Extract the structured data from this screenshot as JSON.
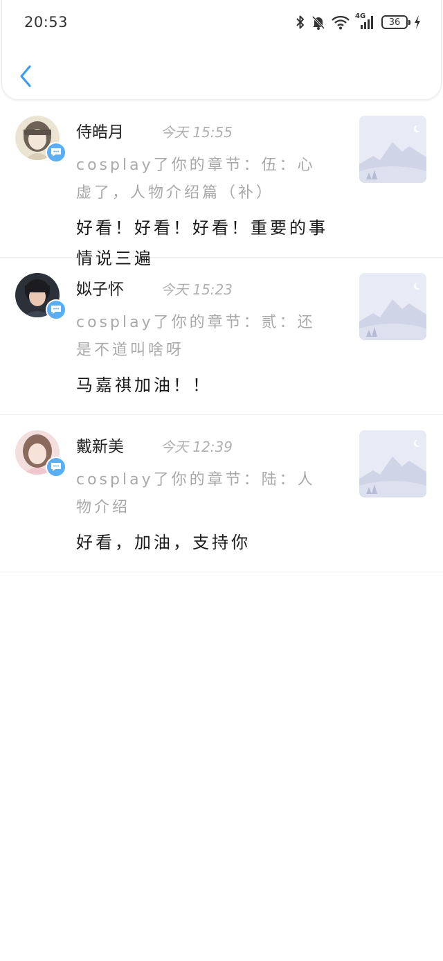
{
  "status_bar": {
    "time": "20:53",
    "network": "4G",
    "battery": "36"
  },
  "colors": {
    "accent": "#3b9cf0",
    "badge": "#5aaef5",
    "muted": "#a9a9a9"
  },
  "comments": [
    {
      "name": "侍皓月",
      "time": "今天 15:55",
      "action": "cosplay了你的章节：伍：心虚了，人物介绍篇（补）",
      "comment": "好看！好看！好看！重要的事情说三遍"
    },
    {
      "name": "姒子怀",
      "time": "今天 15:23",
      "action": "cosplay了你的章节：贰：还是不道叫啥呀",
      "comment": "马嘉祺加油！！"
    },
    {
      "name": "戴新美",
      "time": "今天 12:39",
      "action": "cosplay了你的章节：陆：人物介绍",
      "comment": "好看，加油，支持你"
    }
  ]
}
